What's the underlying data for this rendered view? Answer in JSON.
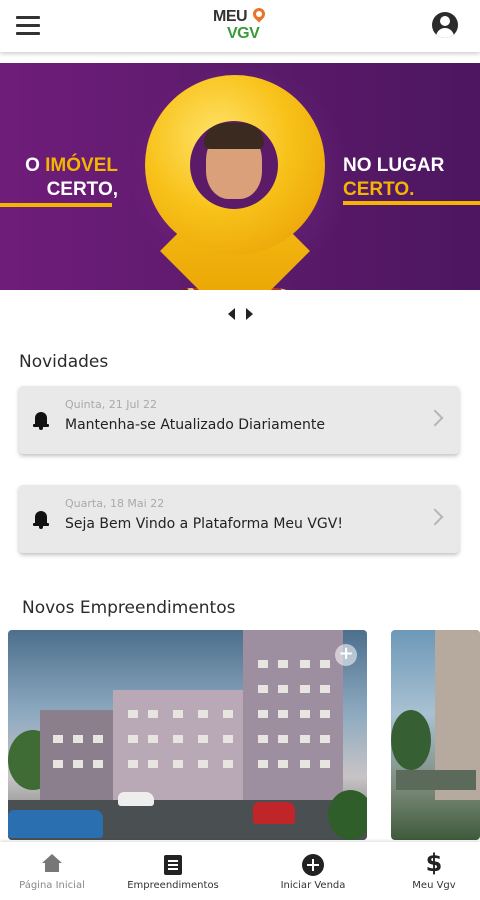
{
  "header": {
    "logo_line1": "MEU",
    "logo_line2": "VGV",
    "menu_icon": "hamburger-menu-icon",
    "account_icon": "account-circle-icon"
  },
  "banner": {
    "left_text_1": "O ",
    "left_text_highlight": "IMÓVEL",
    "left_text_2": "CERTO,",
    "right_text_1": "NO LUGAR",
    "right_text_highlight": "CERTO.",
    "colors": {
      "background": "#6f1d7a",
      "accent": "#f4b400"
    }
  },
  "news": {
    "title": "Novidades",
    "items": [
      {
        "date": "Quinta, 21 Jul 22",
        "text": "Mantenha-se Atualizado Diariamente",
        "icon": "bell-icon"
      },
      {
        "date": "Quarta, 18 Mai 22",
        "text": "Seja Bem Vindo a Plataforma Meu VGV!",
        "icon": "bell-icon"
      }
    ]
  },
  "projects": {
    "title": "Novos Empreendimentos",
    "add_label": "+"
  },
  "bottom_nav": {
    "items": [
      {
        "label": "Página Inicial",
        "icon": "home-icon"
      },
      {
        "label": "Empreendimentos",
        "icon": "list-icon"
      },
      {
        "label": "Iniciar Venda",
        "icon": "add-circle-icon"
      },
      {
        "label": "Meu Vgv",
        "icon": "dollar-icon",
        "glyph": "$"
      }
    ]
  }
}
